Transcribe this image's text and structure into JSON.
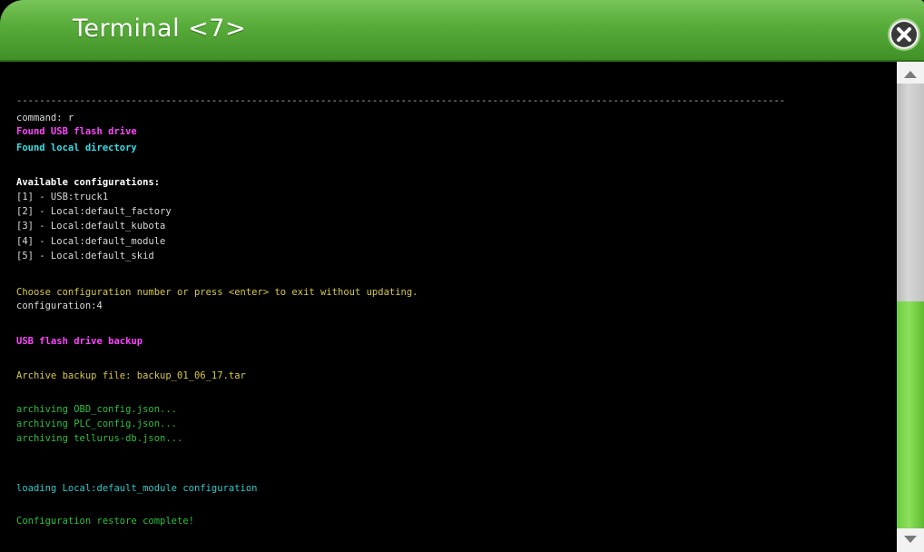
{
  "window": {
    "title": "Terminal <7>"
  },
  "icons": {
    "close": "close-icon",
    "scroll_up": "chevron-up-icon",
    "scroll_down": "chevron-down-icon"
  },
  "colors": {
    "titlebar": "#58ad3a",
    "scroll_thumb": "#7bd44e",
    "text_white": "#d8d8d8",
    "text_magenta": "#ff44ff",
    "text_cyan": "#33e0e8",
    "text_yellow": "#d8c84a",
    "text_green": "#2fbf3f",
    "text_teal": "#2fc9c9"
  },
  "terminal": {
    "lines": [
      {
        "text": "--------------------------------------------------------------------------------------------------------------------------------------",
        "color": "#bdbdbd"
      },
      {
        "text": "command: r",
        "color": "#d8d8d8"
      },
      {
        "text": "Found USB flash drive",
        "color": "#ff44ff",
        "bold": true
      },
      {
        "text": "Found local directory",
        "color": "#33e0e8",
        "bold": true
      },
      {
        "text": "Available configurations:",
        "color": "#ffffff",
        "bold": true
      },
      {
        "text": "[1] - USB:truck1",
        "color": "#d8d8d8"
      },
      {
        "text": "[2] - Local:default_factory",
        "color": "#d8d8d8"
      },
      {
        "text": "[3] - Local:default_kubota",
        "color": "#d8d8d8"
      },
      {
        "text": "[4] - Local:default_module",
        "color": "#d8d8d8"
      },
      {
        "text": "[5] - Local:default_skid",
        "color": "#d8d8d8"
      },
      {
        "text": "Choose configuration number or press <enter> to exit without updating.",
        "color": "#d8c84a"
      },
      {
        "text": "configuration:4",
        "color": "#d8d8d8"
      },
      {
        "text": "USB flash drive backup",
        "color": "#ff44ff",
        "bold": true
      },
      {
        "text": "Archive backup file: backup_01_06_17.tar",
        "color": "#d8c84a"
      },
      {
        "text": "archiving OBD_config.json...",
        "color": "#2fbf3f"
      },
      {
        "text": "archiving PLC_config.json...",
        "color": "#2fbf3f"
      },
      {
        "text": "archiving tellurus-db.json...",
        "color": "#2fbf3f"
      },
      {
        "text": "loading Local:default_module configuration",
        "color": "#2fc9c9"
      },
      {
        "text": "Configuration restore complete!",
        "color": "#2fbf3f"
      }
    ]
  }
}
